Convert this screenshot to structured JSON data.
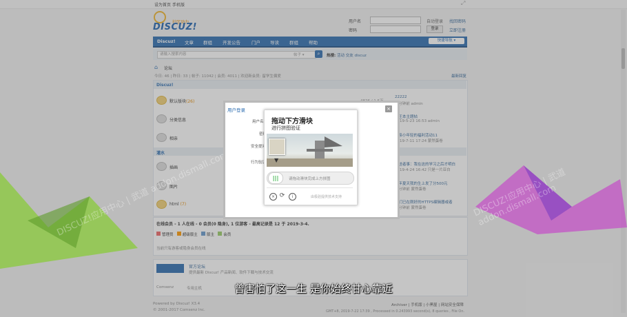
{
  "topbar": {
    "set_home": "设为首页",
    "mobile": "手机版",
    "collapse_icon": "expand-arrows-icon"
  },
  "header": {
    "logo_word": "DISCUZ!",
    "logo_sub": "社区动力",
    "username_label": "用户名",
    "password_label": "密码",
    "autologin": "自动登录",
    "find_password": "找回密码",
    "login_button": "登录",
    "register": "立即注册"
  },
  "nav": {
    "items": [
      "Discuz!",
      "文章",
      "群组",
      "开发公告",
      "门户",
      "导读",
      "群组",
      "帮助"
    ],
    "quick_nav": "快捷导航"
  },
  "search": {
    "placeholder": "请输入搜索内容",
    "scope": "帖子",
    "hot_label": "热搜:",
    "hot_words": "活动 交友 discuz"
  },
  "breadcrumb": {
    "home_icon": "home-icon",
    "current": "论坛"
  },
  "stats": {
    "text": "今日: 46 | 昨日: 33 | 帖子: 11042 | 会员: 4011 | 欢迎新会员: 留学生偏爱",
    "new_posts": "最新回复"
  },
  "forum": {
    "category": "Discuz!",
    "category2": "灌水",
    "rows": [
      {
        "name": "默认版块",
        "count": "(26)",
        "stats": "4826 / 1.5万",
        "last": "22222",
        "meta": "3 分钟前 admin"
      },
      {
        "name": "分类信息",
        "count": "",
        "stats": "",
        "last": "汉王本主题帖",
        "meta": "2019-5-23 16:53 admin"
      },
      {
        "name": "相亲",
        "count": "",
        "stats": "",
        "last": "相亲小年轻的福利活动11",
        "meta": "2019-7-11 17:24 蒙然蛋卷"
      },
      {
        "name": "插画",
        "count": "",
        "stats": "",
        "last": "发送者事：我在这的学习之后才明白",
        "meta": "2019-4-24 16:42 只是一片亚白"
      },
      {
        "name": "图片",
        "count": "",
        "stats": "",
        "last": "每年夏天我的生上发了分500元",
        "meta": "5 分钟前 蒙然蛋卷"
      },
      {
        "name": "html",
        "count": "(7)",
        "stats": "",
        "last": "我们已在刚好的HTTPS编辑器或者",
        "meta": "3 分钟前 蒙然蛋卷"
      }
    ]
  },
  "online": {
    "title": "在线会员 - 1 人在线 - 0 会员(0 隐身), 1 位游客 - 最高记录是 12 于 2019-3-4.",
    "legend": [
      "管理员",
      "超级版主",
      "版主",
      "会员"
    ],
    "note": "当前只有游客或隐身会员在线"
  },
  "links": {
    "title": "官方论坛",
    "desc": "提供最新 Discuz! 产品新闻、软件下载与技术交流",
    "col1": "Comsenz",
    "col2": "专用主机"
  },
  "footer": {
    "powered": "Powered by Discuz! X3.4",
    "copy": "© 2001-2017 Comsenz Inc.",
    "links": "Archiver | 手机版 | 小黑屋 | 网站安全保障",
    "stats": "GMT+8, 2019-7-22 17:39 , Processed in 0.243993 second(s), 8 queries , File On."
  },
  "login_dialog": {
    "title": "用户登录",
    "user_label": "用户名",
    "question_label": "安全提问",
    "pwd_label": "密码",
    "answer_label": "行为验证"
  },
  "captcha": {
    "title": "拖动下方滑块",
    "subtitle": "进行拼图验证",
    "hint": "请拖动滑块完成上方拼图",
    "brand": "由极验提供技术支持",
    "handle_glyph": "|||"
  },
  "subtitle": "曾害怕了这一生 是你始终甘心靠近",
  "watermark": "DISCUZ!应用中心 | 武道 addon.dismall.com",
  "colors": {
    "accent": "#2b6cb0",
    "brand_orange": "#e58a00",
    "slider_green": "#3bb34a"
  }
}
